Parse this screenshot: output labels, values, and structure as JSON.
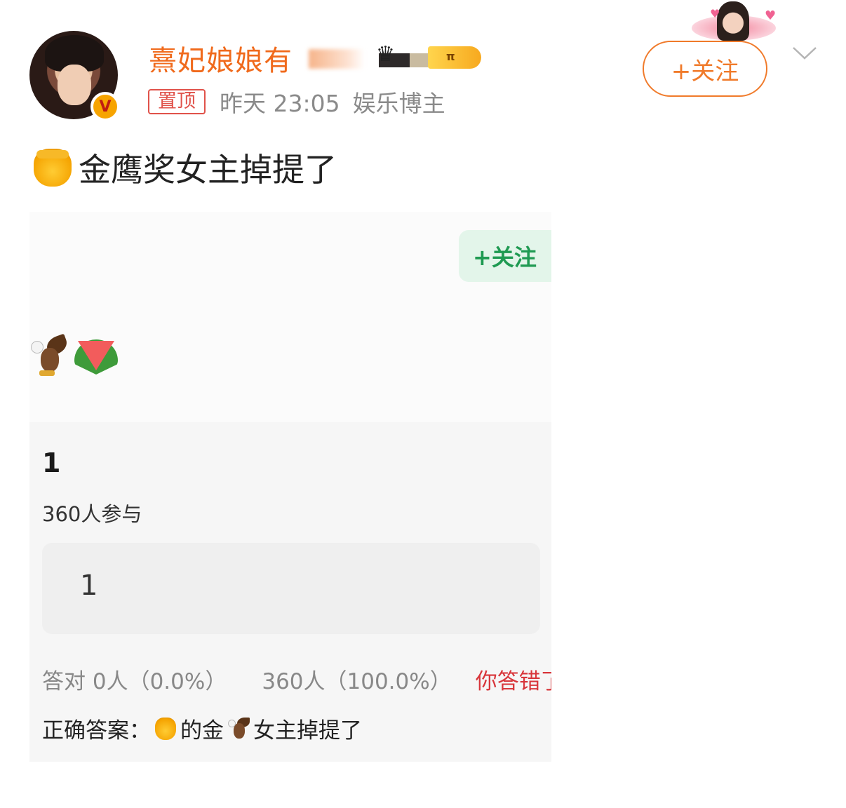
{
  "header": {
    "username": "熹妃娘娘有",
    "pin_label": "置顶",
    "time": "昨天 23:05",
    "role": "娱乐博主",
    "follow_label": "+关注",
    "vip_text": "π",
    "verified_mark": "V"
  },
  "post": {
    "text": "金鹰奖女主掉提了"
  },
  "embedded": {
    "follow_label": "+关注"
  },
  "quiz": {
    "title": "1",
    "participants": "360人参与",
    "option": "1",
    "correct_stat": "答对 0人（0.0%）",
    "other_stat": "360人（100.0%）",
    "wrong_label": "你答错了",
    "answer_label": "正确答案：",
    "answer_part1": "的金",
    "answer_part2": "女主掉提了"
  },
  "colors": {
    "username": "#f06a1c",
    "follow": "#f07a2a",
    "wrong": "#d8363b",
    "green_follow": "#1f9a52"
  },
  "icons": [
    "honey-pot-icon",
    "eagle-icon",
    "watermelon-icon",
    "chevron-down-icon",
    "crown-icon",
    "verified-badge-icon"
  ]
}
